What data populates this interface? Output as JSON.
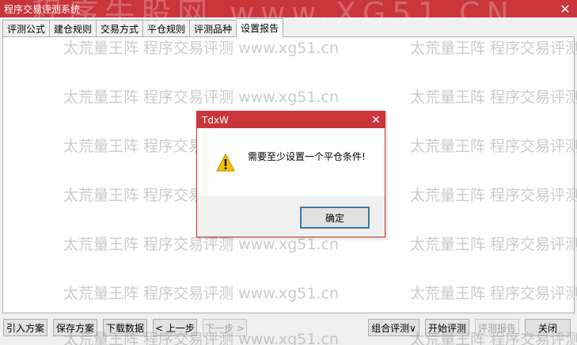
{
  "window": {
    "title": "程序交易评测系统"
  },
  "tabs": [
    "评测公式",
    "建仓规则",
    "交易方式",
    "平仓规则",
    "评测品种",
    "设置报告"
  ],
  "active_tab_index": 5,
  "watermark": {
    "text": "太荒量王阵 程序交易评测 www.xg51.cn",
    "big_text": "程序牛股网 www.XG51.CN"
  },
  "buttons": {
    "import_scheme": "引入方案",
    "save_scheme": "保存方案",
    "download_data": "下载数据",
    "prev_step": "< 上一步",
    "next_step": "下一步 >",
    "combo_eval": "组合评测∨",
    "start_eval": "开始评测",
    "eval_report": "评测报告",
    "close": "关闭"
  },
  "dialog": {
    "title": "TdxW",
    "message": "需要至少设置一个平仓条件!",
    "ok_label": "确定"
  },
  "colors": {
    "accent": "#c8353b",
    "warning": "#f4c300"
  }
}
